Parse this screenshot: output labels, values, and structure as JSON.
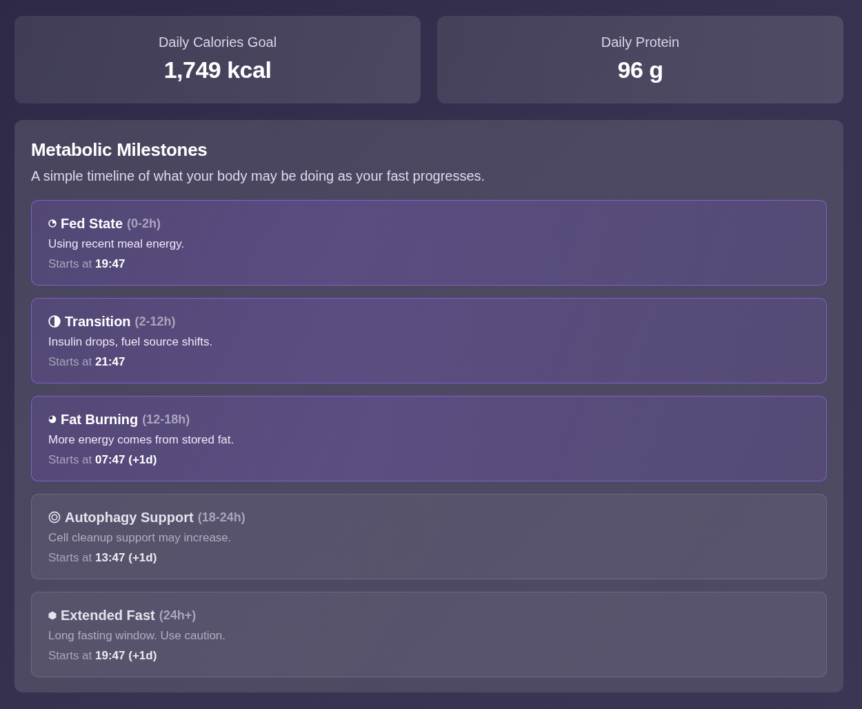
{
  "stats": [
    {
      "label": "Daily Calories Goal",
      "value": "1,749 kcal"
    },
    {
      "label": "Daily Protein",
      "value": "96 g"
    }
  ],
  "milestones_panel": {
    "title": "Metabolic Milestones",
    "subtitle": "A simple timeline of what your body may be doing as your fast progresses.",
    "milestones": [
      {
        "kind": "quarter",
        "name": "Fed State",
        "range": "(0-2h)",
        "description": "Using recent meal energy.",
        "start": "Starts at **19:47**",
        "reached": true
      },
      {
        "kind": "half",
        "name": "Transition",
        "range": "(2-12h)",
        "description": "Insulin drops, fuel source shifts.",
        "start": "Starts at **21:47**",
        "reached": true
      },
      {
        "kind": "threequarter",
        "name": "Fat Burning",
        "range": "(12-18h)",
        "description": "More energy comes from stored fat.",
        "start": "Starts at **07:47 (+1d)**",
        "reached": true
      },
      {
        "kind": "rings",
        "name": "Autophagy Support",
        "range": "(18-24h)",
        "description": "Cell cleanup support may increase.",
        "start": "Starts at **13:47 (+1d)**",
        "reached": false
      },
      {
        "kind": "hexagon",
        "name": "Extended Fast",
        "range": "(24h+)",
        "description": "Long fasting window. Use caution.",
        "start": "Starts at **19:47 (+1d)**",
        "reached": false
      }
    ]
  }
}
